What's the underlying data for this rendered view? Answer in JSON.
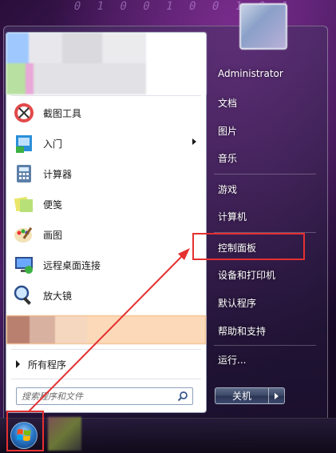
{
  "start_menu": {
    "left_items": [
      {
        "label": "截图工具",
        "icon": "snipping-tool-icon",
        "has_submenu": false
      },
      {
        "label": "入门",
        "icon": "getting-started-icon",
        "has_submenu": true
      },
      {
        "label": "计算器",
        "icon": "calculator-icon",
        "has_submenu": false
      },
      {
        "label": "便笺",
        "icon": "sticky-notes-icon",
        "has_submenu": false
      },
      {
        "label": "画图",
        "icon": "paint-icon",
        "has_submenu": false
      },
      {
        "label": "远程桌面连接",
        "icon": "remote-desktop-icon",
        "has_submenu": false
      },
      {
        "label": "放大镜",
        "icon": "magnifier-icon",
        "has_submenu": false
      }
    ],
    "all_programs_label": "所有程序",
    "search": {
      "placeholder": "搜索程序和文件",
      "value": ""
    },
    "right_items": [
      {
        "label": "Administrator"
      },
      {
        "label": "文档"
      },
      {
        "label": "图片"
      },
      {
        "label": "音乐"
      },
      {
        "label": "游戏"
      },
      {
        "label": "计算机"
      },
      {
        "label": "控制面板"
      },
      {
        "label": "设备和打印机"
      },
      {
        "label": "默认程序"
      },
      {
        "label": "帮助和支持"
      },
      {
        "label": "运行..."
      }
    ],
    "shutdown_label": "关机"
  },
  "desktop": {
    "background_digits": "0 1 0 0 1 0 0 1 0 1"
  },
  "colors": {
    "annotation_red": "#e53030",
    "left_pane_bg": "#ffffff",
    "right_text": "#ffffff"
  }
}
